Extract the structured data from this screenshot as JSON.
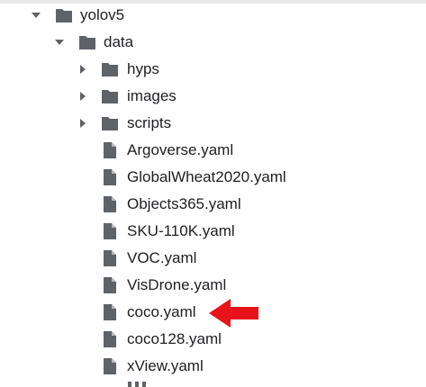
{
  "tree": {
    "items": [
      {
        "label": "yolov5",
        "type": "folder",
        "expanded": true
      },
      {
        "label": "data",
        "type": "folder",
        "expanded": true
      },
      {
        "label": "hyps",
        "type": "folder",
        "expanded": false
      },
      {
        "label": "images",
        "type": "folder",
        "expanded": false
      },
      {
        "label": "scripts",
        "type": "folder",
        "expanded": false
      },
      {
        "label": "Argoverse.yaml",
        "type": "file"
      },
      {
        "label": "GlobalWheat2020.yaml",
        "type": "file"
      },
      {
        "label": "Objects365.yaml",
        "type": "file"
      },
      {
        "label": "SKU-110K.yaml",
        "type": "file"
      },
      {
        "label": "VOC.yaml",
        "type": "file"
      },
      {
        "label": "VisDrone.yaml",
        "type": "file"
      },
      {
        "label": "coco.yaml",
        "type": "file",
        "highlighted": true
      },
      {
        "label": "coco128.yaml",
        "type": "file"
      },
      {
        "label": "xView.yaml",
        "type": "file"
      }
    ]
  },
  "annotation": {
    "arrow_color": "#e8141c",
    "points_to": "coco.yaml"
  },
  "colors": {
    "icon": "#5f6368",
    "text": "#202124"
  }
}
